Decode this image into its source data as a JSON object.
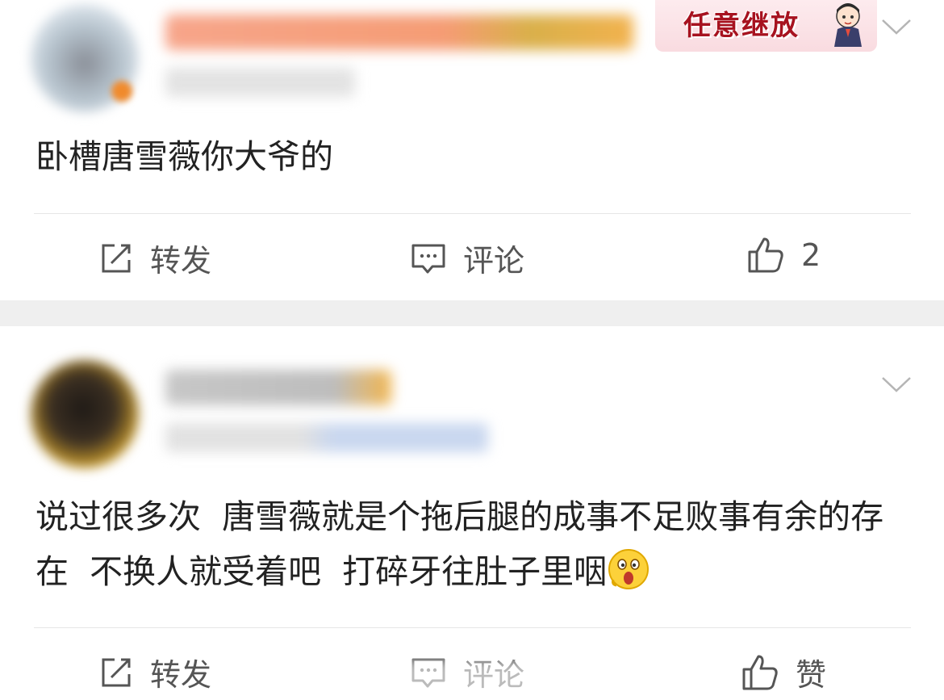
{
  "posts": [
    {
      "sticker_text": "任意继放",
      "content": "卧槽唐雪薇你大爷的",
      "actions": {
        "repost": "转发",
        "comment": "评论",
        "like": "2"
      }
    },
    {
      "content": "说过很多次  唐雪薇就是个拖后腿的成事不足败事有余的存在  不换人就受着吧  打碎牙往肚子里咽",
      "actions": {
        "repost": "转发",
        "comment": "评论",
        "like": "赞"
      }
    }
  ],
  "icons": {
    "repost": "repost-icon",
    "comment": "comment-icon",
    "like": "thumbs-up-icon",
    "more": "chevron-down-icon",
    "emoji": "shocked-face-emoji"
  },
  "colors": {
    "text": "#222222",
    "action_text": "#555555",
    "separator": "#efefef",
    "sticker_red": "#a7121f"
  }
}
